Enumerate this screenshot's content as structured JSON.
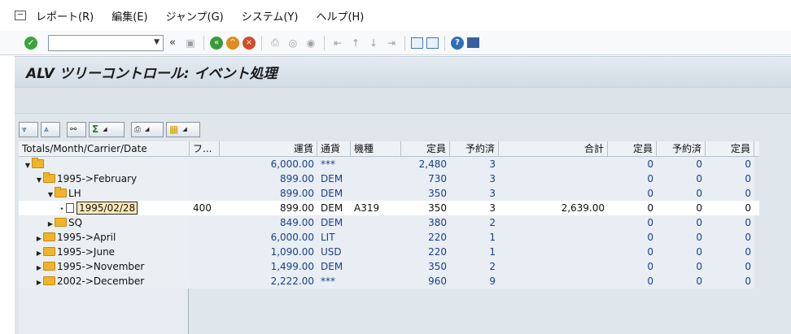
{
  "menubar": {
    "items": [
      "レポート(R)",
      "編集(E)",
      "ジャンプ(G)",
      "システム(Y)",
      "ヘルプ(H)"
    ]
  },
  "toolbar": {
    "command_field_value": "",
    "icons": [
      "enter-icon",
      "save-icon",
      "back-icon",
      "exit-icon",
      "cancel-icon",
      "print-icon",
      "find-icon",
      "find-next-icon",
      "first-page-icon",
      "previous-page-icon",
      "next-page-icon",
      "last-page-icon",
      "create-session-icon",
      "shortcut-icon",
      "help-icon",
      "layout-menu-icon"
    ]
  },
  "title": "ALV ツリーコントロール: イベント処理",
  "alv_toolbar": {
    "buttons": [
      "expand-icon",
      "collapse-icon",
      "find-icon",
      "sum-icon",
      "print-icon",
      "layout-icon"
    ]
  },
  "table": {
    "columns": [
      "Totals/Month/Carrier/Date",
      "フ...",
      "運賃",
      "通貨",
      "機種",
      "定員",
      "予約済",
      "合計",
      "定員",
      "予約済",
      "定員"
    ],
    "rows": [
      {
        "level": 0,
        "expander": "▼",
        "icon": "folder-open",
        "label": "",
        "f": "",
        "fare": "6,000.00",
        "cur": "***",
        "plane": "",
        "seats": "2,480",
        "booked": "3",
        "total": "",
        "s2": "0",
        "b2": "0",
        "s3": "0"
      },
      {
        "level": 1,
        "expander": "▼",
        "icon": "folder-open",
        "label": "1995->February",
        "f": "",
        "fare": "899.00",
        "cur": "DEM",
        "plane": "",
        "seats": "730",
        "booked": "3",
        "total": "",
        "s2": "0",
        "b2": "0",
        "s3": "0"
      },
      {
        "level": 2,
        "expander": "▼",
        "icon": "folder-open",
        "label": "LH",
        "f": "",
        "fare": "899.00",
        "cur": "DEM",
        "plane": "",
        "seats": "350",
        "booked": "3",
        "total": "",
        "s2": "0",
        "b2": "0",
        "s3": "0"
      },
      {
        "level": 3,
        "expander": "•",
        "icon": "document",
        "label": "1995/02/28",
        "f": "400",
        "fare": "899.00",
        "cur": "DEM",
        "plane": "A319",
        "seats": "350",
        "booked": "3",
        "total": "2,639.00",
        "s2": "0",
        "b2": "0",
        "s3": "0",
        "selected": true
      },
      {
        "level": 2,
        "expander": "▶",
        "icon": "folder",
        "label": "SQ",
        "f": "",
        "fare": "849.00",
        "cur": "DEM",
        "plane": "",
        "seats": "380",
        "booked": "2",
        "total": "",
        "s2": "0",
        "b2": "0",
        "s3": "0"
      },
      {
        "level": 1,
        "expander": "▶",
        "icon": "folder",
        "label": "1995->April",
        "f": "",
        "fare": "6,000.00",
        "cur": "LIT",
        "plane": "",
        "seats": "220",
        "booked": "1",
        "total": "",
        "s2": "0",
        "b2": "0",
        "s3": "0"
      },
      {
        "level": 1,
        "expander": "▶",
        "icon": "folder",
        "label": "1995->June",
        "f": "",
        "fare": "1,090.00",
        "cur": "USD",
        "plane": "",
        "seats": "220",
        "booked": "1",
        "total": "",
        "s2": "0",
        "b2": "0",
        "s3": "0"
      },
      {
        "level": 1,
        "expander": "▶",
        "icon": "folder",
        "label": "1995->November",
        "f": "",
        "fare": "1,499.00",
        "cur": "DEM",
        "plane": "",
        "seats": "350",
        "booked": "2",
        "total": "",
        "s2": "0",
        "b2": "0",
        "s3": "0"
      },
      {
        "level": 1,
        "expander": "▶",
        "icon": "folder",
        "label": "2002->December",
        "f": "",
        "fare": "2,222.00",
        "cur": "***",
        "plane": "",
        "seats": "960",
        "booked": "9",
        "total": "",
        "s2": "0",
        "b2": "0",
        "s3": "0"
      }
    ]
  }
}
